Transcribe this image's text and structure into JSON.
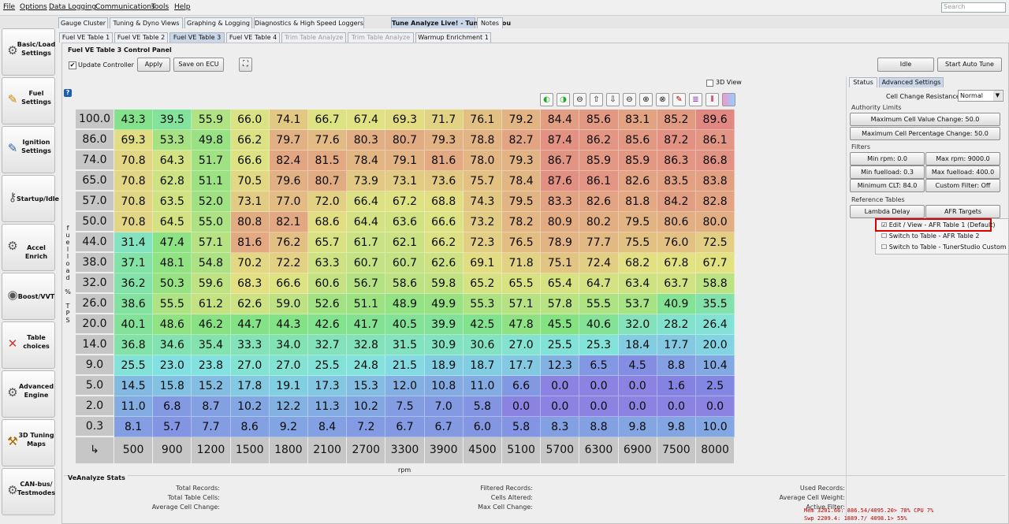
{
  "menu": [
    "File",
    "Options",
    "Data Logging",
    "Communications",
    "Tools",
    "Help"
  ],
  "search_placeholder": "Search",
  "top_tabs": [
    {
      "label": "Gauge Cluster"
    },
    {
      "label": "Tuning & Dyno Views"
    },
    {
      "label": "Graphing & Logging"
    },
    {
      "label": "Diagnostics & High Speed Loggers"
    },
    {
      "label": "Tune Analyze Live! - Tune For You",
      "active": true
    },
    {
      "label": "Notes"
    }
  ],
  "sidebar": [
    {
      "label": "Basic/Load\nSettings",
      "icon": "gear-icon",
      "glyph": "⚙"
    },
    {
      "label": "Fuel\nSettings",
      "icon": "injector-icon",
      "glyph": "✎"
    },
    {
      "label": "Ignition\nSettings",
      "icon": "spark-plug-icon",
      "glyph": "✎"
    },
    {
      "label": "Startup/Idle",
      "icon": "key-icon",
      "glyph": "⚷"
    },
    {
      "label": "Accel Enrich",
      "icon": "gears-icon",
      "glyph": "⚙"
    },
    {
      "label": "Boost/VVT",
      "icon": "turbo-icon",
      "glyph": "◉"
    },
    {
      "label": "Table\nchoices",
      "icon": "tools-icon",
      "glyph": "✕"
    },
    {
      "label": "Advanced\nEngine",
      "icon": "gears-icon",
      "glyph": "⚙"
    },
    {
      "label": "3D Tuning\nMaps",
      "icon": "hammer-icon",
      "glyph": "⚒"
    },
    {
      "label": "CAN-bus/\nTestmodes",
      "icon": "gear-icon",
      "glyph": "⚙"
    }
  ],
  "sub_tabs": [
    {
      "label": "Fuel VE Table 1"
    },
    {
      "label": "Fuel VE Table 2"
    },
    {
      "label": "Fuel VE Table 3",
      "active": true
    },
    {
      "label": "Fuel VE Table 4"
    },
    {
      "label": "Trim Table Analyze",
      "disabled": true
    },
    {
      "label": "Trim Table Analyze",
      "disabled": true
    },
    {
      "label": "Warmup Enrichment 1"
    }
  ],
  "control_panel": {
    "title": "Fuel VE Table 3 Control Panel",
    "update_controller": "Update Controller",
    "apply": "Apply",
    "save_ecu": "Save on ECU",
    "idle": "Idle",
    "start_auto_tune": "Start Auto Tune",
    "view3d": "3D View"
  },
  "toolbar_icons": [
    "go-green-icon",
    "go-green-icon",
    "minus-icon",
    "arrow-up-icon",
    "arrow-down-icon",
    "minus-icon",
    "plus-icon",
    "times-icon",
    "pencil-icon",
    "lines-icon",
    "bars-icon",
    "gradient-icon"
  ],
  "axis": {
    "y_title": "fuelload % TPS",
    "x_title": "rpm",
    "y": [
      "100.0",
      "86.0",
      "74.0",
      "65.0",
      "57.0",
      "50.0",
      "44.0",
      "38.0",
      "32.0",
      "26.0",
      "20.0",
      "14.0",
      "9.0",
      "5.0",
      "2.0",
      "0.3"
    ],
    "x": [
      "500",
      "900",
      "1200",
      "1500",
      "1800",
      "2100",
      "2700",
      "3300",
      "3900",
      "4500",
      "5100",
      "5700",
      "6300",
      "6900",
      "7500",
      "8000"
    ]
  },
  "table": [
    [
      "43.3",
      "39.5",
      "55.9",
      "66.0",
      "74.1",
      "66.7",
      "67.4",
      "69.3",
      "71.7",
      "76.1",
      "79.2",
      "84.4",
      "85.6",
      "83.1",
      "85.2",
      "89.6"
    ],
    [
      "69.3",
      "53.3",
      "49.8",
      "66.2",
      "79.7",
      "77.6",
      "80.3",
      "80.7",
      "79.3",
      "78.8",
      "82.7",
      "87.4",
      "86.2",
      "85.6",
      "87.2",
      "86.1"
    ],
    [
      "70.8",
      "64.3",
      "51.7",
      "66.6",
      "82.4",
      "81.5",
      "78.4",
      "79.1",
      "81.6",
      "78.0",
      "79.3",
      "86.7",
      "85.9",
      "85.9",
      "86.3",
      "86.8"
    ],
    [
      "70.8",
      "62.8",
      "51.1",
      "70.5",
      "79.6",
      "80.7",
      "73.9",
      "73.1",
      "73.6",
      "75.7",
      "78.4",
      "87.6",
      "86.1",
      "82.6",
      "83.5",
      "83.8"
    ],
    [
      "70.8",
      "63.5",
      "52.0",
      "73.1",
      "77.0",
      "72.0",
      "66.4",
      "67.2",
      "68.8",
      "74.3",
      "79.5",
      "83.3",
      "82.6",
      "81.8",
      "84.2",
      "82.8"
    ],
    [
      "70.8",
      "64.5",
      "55.0",
      "80.8",
      "82.1",
      "68.6",
      "64.4",
      "63.6",
      "66.6",
      "73.2",
      "78.2",
      "80.9",
      "80.2",
      "79.5",
      "80.6",
      "80.0"
    ],
    [
      "31.4",
      "47.4",
      "57.1",
      "81.6",
      "76.2",
      "65.7",
      "61.7",
      "62.1",
      "66.2",
      "72.3",
      "76.5",
      "78.9",
      "77.7",
      "75.5",
      "76.0",
      "72.5"
    ],
    [
      "37.1",
      "48.1",
      "54.8",
      "70.2",
      "72.2",
      "63.3",
      "60.7",
      "60.7",
      "62.6",
      "69.1",
      "71.8",
      "75.1",
      "72.4",
      "68.2",
      "67.8",
      "67.7"
    ],
    [
      "36.2",
      "50.3",
      "59.6",
      "68.3",
      "66.6",
      "60.6",
      "56.7",
      "58.6",
      "59.8",
      "65.2",
      "65.5",
      "65.4",
      "64.7",
      "63.4",
      "63.7",
      "58.8"
    ],
    [
      "38.6",
      "55.5",
      "61.2",
      "62.6",
      "59.0",
      "52.6",
      "51.1",
      "48.9",
      "49.9",
      "55.3",
      "57.1",
      "57.8",
      "55.5",
      "53.7",
      "40.9",
      "35.5"
    ],
    [
      "40.1",
      "48.6",
      "46.2",
      "44.7",
      "44.3",
      "42.6",
      "41.7",
      "40.5",
      "39.9",
      "42.5",
      "47.8",
      "45.5",
      "40.6",
      "32.0",
      "28.2",
      "26.4"
    ],
    [
      "36.8",
      "34.6",
      "35.4",
      "33.3",
      "34.0",
      "32.7",
      "32.8",
      "31.5",
      "30.9",
      "30.6",
      "27.0",
      "25.5",
      "25.3",
      "18.4",
      "17.7",
      "20.0"
    ],
    [
      "25.5",
      "23.0",
      "23.8",
      "27.0",
      "27.0",
      "25.5",
      "24.8",
      "21.5",
      "18.9",
      "18.7",
      "17.7",
      "12.3",
      "6.5",
      "4.5",
      "8.8",
      "10.4"
    ],
    [
      "14.5",
      "15.8",
      "15.2",
      "17.8",
      "19.1",
      "17.3",
      "15.3",
      "12.0",
      "10.8",
      "11.0",
      "6.6",
      "0.0",
      "0.0",
      "0.0",
      "1.6",
      "2.5"
    ],
    [
      "11.0",
      "6.8",
      "8.7",
      "10.2",
      "12.2",
      "11.3",
      "10.2",
      "7.5",
      "7.0",
      "5.8",
      "0.0",
      "0.0",
      "0.0",
      "0.0",
      "0.0",
      "0.0"
    ],
    [
      "8.1",
      "5.7",
      "7.7",
      "8.6",
      "9.2",
      "8.4",
      "7.2",
      "6.7",
      "6.7",
      "6.0",
      "5.8",
      "8.3",
      "8.8",
      "9.8",
      "9.8",
      "10.0"
    ]
  ],
  "right_panel": {
    "tabs": [
      "Status",
      "Advanced Settings"
    ],
    "cell_change_label": "Cell Change Resistance:",
    "cell_change_value": "Normal",
    "authority_title": "Authority Limits",
    "max_cell_value": "Maximum Cell Value Change: 50.0",
    "max_cell_pct": "Maximum Cell Percentage Change: 50.0",
    "filters_title": "Filters",
    "filters": [
      "Min rpm: 0.0",
      "Max rpm: 9000.0",
      "Min fuelload: 0.3",
      "Max fuelload: 400.0",
      "Minimum CLT: 84.0",
      "Custom Filter: Off"
    ],
    "ref_title": "Reference Tables",
    "lambda_delay": "Lambda Delay",
    "afr_targets": "AFR Targets",
    "dropdown": [
      {
        "label": "Edit / View - AFR Table 1 (Default)",
        "checked": true
      },
      {
        "label": "Switch to Table - AFR Table 2",
        "checked": false
      },
      {
        "label": "Switch to Table - TunerStudio Custom",
        "checked": false
      }
    ]
  },
  "stats": {
    "title": "VeAnalyze Stats",
    "labels": [
      "Total Records:",
      "Total Table Cells:",
      "Average Cell Change:",
      "Filtered Records:",
      "Cells Altered:",
      "Max Cell Change:",
      "Used Records:",
      "Average Cell Weight:",
      "Active Filter:"
    ]
  },
  "monitor": {
    "line1": "Mem 3201.66: 886.54/4095.20> 78% CPU  7%",
    "line2": "Swp 2209.4: 1889.7/ 4098.1> 55%"
  }
}
